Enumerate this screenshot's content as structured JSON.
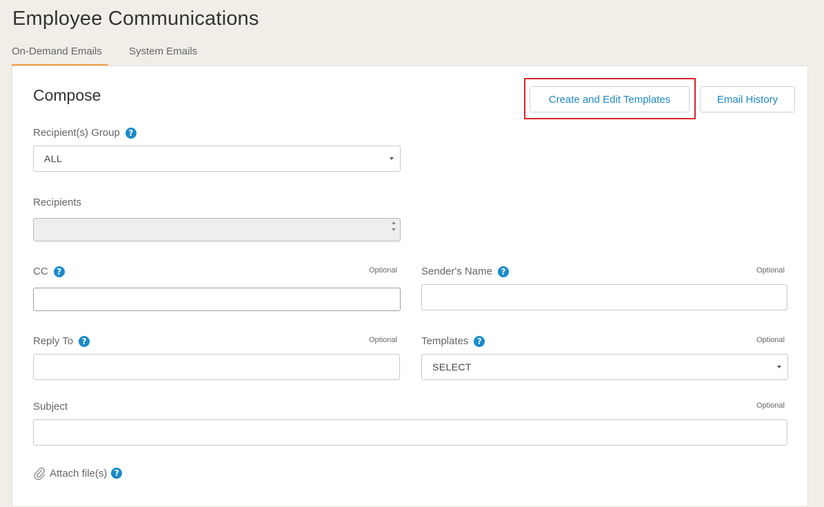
{
  "page": {
    "title": "Employee Communications"
  },
  "tabs": [
    {
      "label": "On-Demand Emails",
      "active": true
    },
    {
      "label": "System Emails",
      "active": false
    }
  ],
  "compose": {
    "title": "Compose",
    "buttons": {
      "templates": "Create and Edit Templates",
      "history": "Email History"
    },
    "recipient_group": {
      "label": "Recipient(s) Group",
      "value": "ALL"
    },
    "recipients": {
      "label": "Recipients",
      "value": ""
    },
    "cc": {
      "label": "CC",
      "optional": "Optional",
      "value": ""
    },
    "sender_name": {
      "label": "Sender's Name",
      "optional": "Optional",
      "value": ""
    },
    "reply_to": {
      "label": "Reply To",
      "optional": "Optional",
      "value": ""
    },
    "templates": {
      "label": "Templates",
      "optional": "Optional",
      "value": "SELECT"
    },
    "subject": {
      "label": "Subject",
      "optional": "Optional",
      "value": ""
    },
    "attach": {
      "label": "Attach file(s)"
    },
    "help_glyph": "?"
  },
  "colors": {
    "accent_tab": "#f0a04b",
    "link_blue": "#1f88c2",
    "help_blue": "#1a8bc8",
    "highlight_red": "#d7232e"
  },
  "icons": {
    "help": "question-circle-icon",
    "attach": "paperclip-icon",
    "dropdown": "caret-down-icon"
  }
}
